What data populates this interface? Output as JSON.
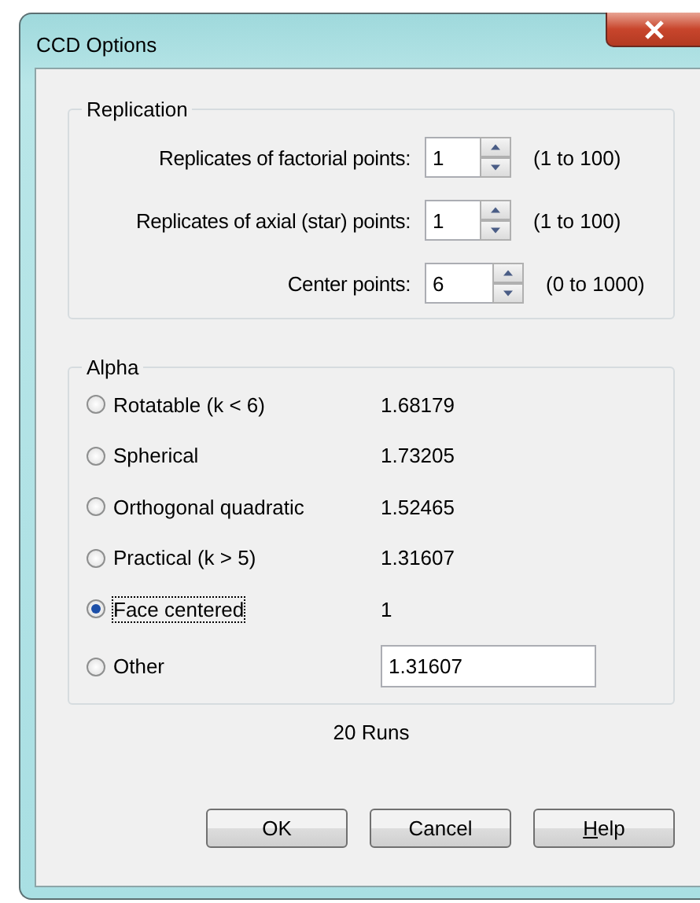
{
  "window": {
    "title": "CCD Options"
  },
  "replication": {
    "title": "Replication",
    "rows": [
      {
        "label": "Replicates of factorial points:",
        "value": "1",
        "range": "(1 to 100)"
      },
      {
        "label": "Replicates of axial (star) points:",
        "value": "1",
        "range": "(1 to 100)"
      },
      {
        "label": "Center points:",
        "value": "6",
        "range": "(0 to 1000)"
      }
    ]
  },
  "alpha": {
    "title": "Alpha",
    "options": [
      {
        "kind": "fixed",
        "label": "Rotatable (k < 6)",
        "value": "1.68179",
        "selected": false,
        "focused": false
      },
      {
        "kind": "fixed",
        "label": "Spherical",
        "value": "1.73205",
        "selected": false,
        "focused": false
      },
      {
        "kind": "fixed",
        "label": "Orthogonal quadratic",
        "value": "1.52465",
        "selected": false,
        "focused": false
      },
      {
        "kind": "fixed",
        "label": "Practical (k > 5)",
        "value": "1.31607",
        "selected": false,
        "focused": false
      },
      {
        "kind": "fixed",
        "label": "Face centered",
        "value": "1",
        "selected": true,
        "focused": true
      },
      {
        "kind": "input",
        "label": "Other",
        "value": "1.31607",
        "selected": false,
        "focused": false
      }
    ]
  },
  "runs": "20 Runs",
  "buttons": [
    {
      "label": "OK",
      "mnemonic": false
    },
    {
      "label": "Cancel",
      "mnemonic": false
    },
    {
      "label": "Help",
      "mnemonic": true
    }
  ]
}
